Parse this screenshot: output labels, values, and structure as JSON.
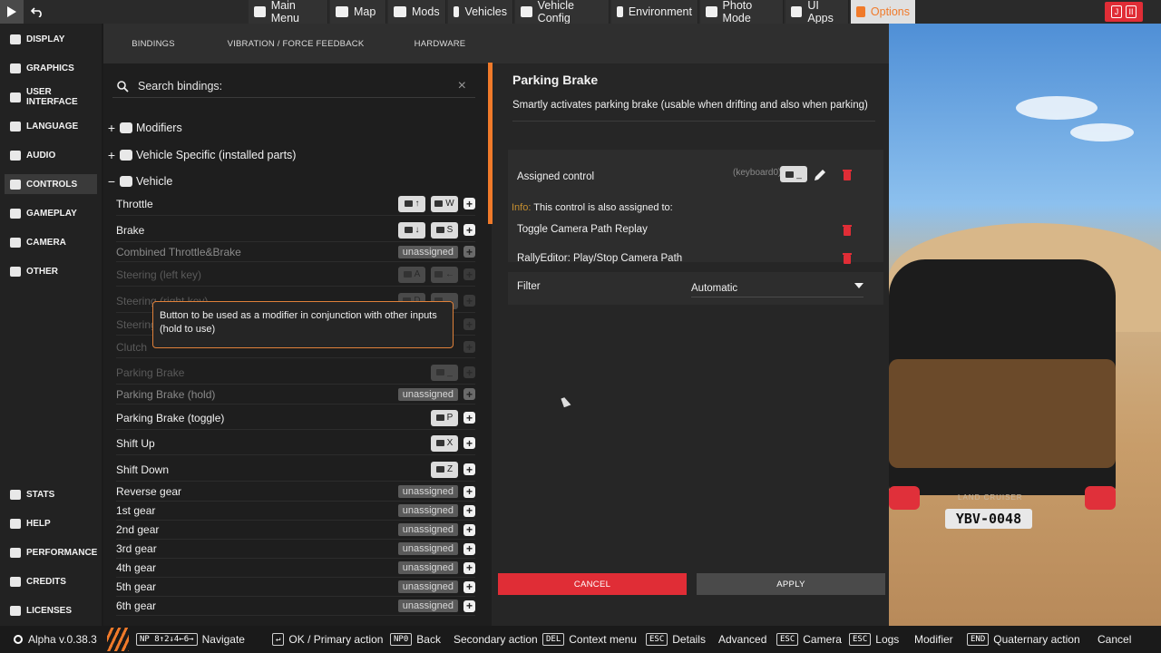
{
  "topbar": {
    "play_icon": "play-icon",
    "back_icon": "undo-icon",
    "menu": [
      {
        "label": "Main Menu",
        "icon": "grid-icon"
      },
      {
        "label": "Map",
        "icon": "map-icon"
      },
      {
        "label": "Mods",
        "icon": "puzzle-icon"
      },
      {
        "label": "Vehicles",
        "icon": "car-icon"
      },
      {
        "label": "Vehicle Config",
        "icon": "car-config-icon"
      },
      {
        "label": "Environment",
        "icon": "cloud-sun-icon"
      },
      {
        "label": "Photo Mode",
        "icon": "camera-icon"
      },
      {
        "label": "UI Apps",
        "icon": "apps-icon"
      },
      {
        "label": "Options",
        "icon": "sliders-icon"
      }
    ],
    "right_labels": [
      "J",
      "II"
    ]
  },
  "sidebar": {
    "items": [
      {
        "label": "DISPLAY"
      },
      {
        "label": "GRAPHICS"
      },
      {
        "label": "USER INTERFACE"
      },
      {
        "label": "LANGUAGE"
      },
      {
        "label": "AUDIO"
      },
      {
        "label": "CONTROLS"
      },
      {
        "label": "GAMEPLAY"
      },
      {
        "label": "CAMERA"
      },
      {
        "label": "OTHER"
      }
    ],
    "bottom_items": [
      {
        "label": "STATS"
      },
      {
        "label": "HELP"
      },
      {
        "label": "PERFORMANCE"
      },
      {
        "label": "CREDITS"
      },
      {
        "label": "LICENSES"
      }
    ]
  },
  "tabs": [
    "BINDINGS",
    "VIBRATION / FORCE FEEDBACK",
    "HARDWARE"
  ],
  "search": {
    "placeholder": "Search bindings:"
  },
  "groups": [
    {
      "label": "Modifiers",
      "pm": "+"
    },
    {
      "label": "Vehicle Specific (installed parts)",
      "pm": "+"
    },
    {
      "label": "Vehicle",
      "pm": "−"
    }
  ],
  "bindings": [
    {
      "label": "Throttle",
      "keys": [
        "↑",
        "W"
      ]
    },
    {
      "label": "Brake",
      "keys": [
        "↓",
        "S"
      ]
    },
    {
      "label": "Combined Throttle&Brake",
      "unassigned": "unassigned"
    },
    {
      "label": "Steering (left key)",
      "keys": [
        "A",
        "←"
      ]
    },
    {
      "label": "Steering (right key)",
      "keys": [
        "D",
        "→"
      ]
    },
    {
      "label": "Steering",
      "keys": []
    },
    {
      "label": "Clutch",
      "keys": []
    },
    {
      "label": "Parking Brake",
      "keys": [
        "_"
      ]
    },
    {
      "label": "Parking Brake (hold)",
      "unassigned": "unassigned"
    },
    {
      "label": "Parking Brake (toggle)",
      "keys": [
        "P"
      ]
    },
    {
      "label": "Shift Up",
      "keys": [
        "X"
      ]
    },
    {
      "label": "Shift Down",
      "keys": [
        "Z"
      ]
    },
    {
      "label": "Reverse gear",
      "unassigned": "unassigned"
    },
    {
      "label": "1st gear",
      "unassigned": "unassigned"
    },
    {
      "label": "2nd gear",
      "unassigned": "unassigned"
    },
    {
      "label": "3rd gear",
      "unassigned": "unassigned"
    },
    {
      "label": "4th gear",
      "unassigned": "unassigned"
    },
    {
      "label": "5th gear",
      "unassigned": "unassigned"
    },
    {
      "label": "6th gear",
      "unassigned": "unassigned"
    }
  ],
  "tooltip": "Button to be used as a modifier in conjunction with other inputs (hold to use)",
  "detail": {
    "title": "Parking Brake",
    "description": "Smartly activates parking brake (usable when drifting and also when parking)",
    "assigned_label": "Assigned control",
    "device": "(keyboard0)",
    "key": "_",
    "info_prefix": "Info:",
    "info_text": "This control is also assigned to:",
    "also_assigned": [
      "Toggle Camera Path Replay",
      "RallyEditor: Play/Stop Camera Path"
    ],
    "filter_label": "Filter",
    "filter_value": "Automatic",
    "cancel": "CANCEL",
    "apply": "APPLY"
  },
  "bottombar": {
    "version": "Alpha v.0.38.3",
    "hints": [
      {
        "key": "NP 8↑2↓4←6→",
        "label": "Navigate"
      },
      {
        "key": "↵",
        "label": "OK / Primary action"
      },
      {
        "key": "NP0",
        "label": "Back"
      },
      {
        "key": "",
        "label": "Secondary action"
      },
      {
        "key": "DEL",
        "label": "Context menu"
      },
      {
        "key": "ESC",
        "label": "Details"
      },
      {
        "key": "",
        "label": "Advanced"
      },
      {
        "key": "ESC",
        "label": "Camera"
      },
      {
        "key": "ESC",
        "label": "Logs"
      },
      {
        "key": "",
        "label": "Modifier"
      },
      {
        "key": "END",
        "label": "Quaternary action"
      },
      {
        "key": "",
        "label": "Cancel"
      }
    ]
  },
  "scene": {
    "plate": "YBV-0048",
    "badge": "LAND CRUISER"
  },
  "colors": {
    "accent": "#f07a2a",
    "danger": "#e02d36",
    "apply": "#4a4a4a"
  }
}
